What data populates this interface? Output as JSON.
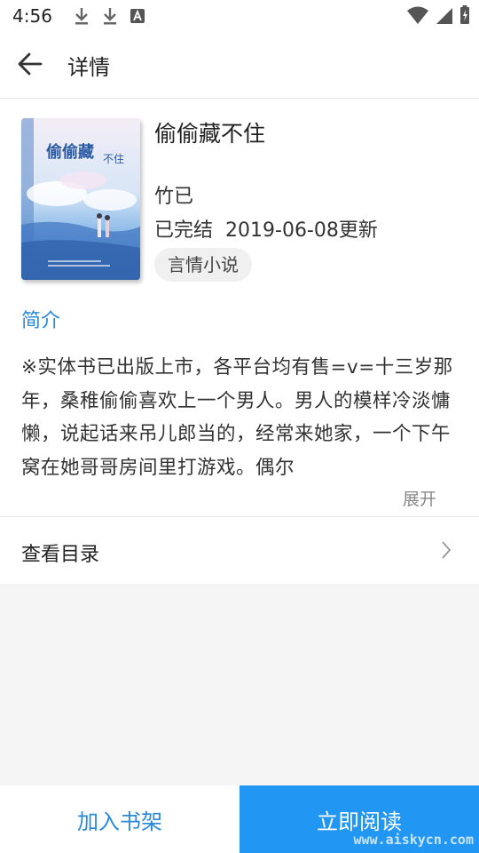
{
  "status_bar": {
    "time": "4:56"
  },
  "app_bar": {
    "title": "详情"
  },
  "book": {
    "title": "偷偷藏不住",
    "author": "竹已",
    "status": "已完结",
    "updated": "2019-06-08更新",
    "genre": "言情小说",
    "cover_title": "偷偷藏不住"
  },
  "intro": {
    "heading": "简介",
    "text": "※实体书已出版上市，各平台均有售=v=十三岁那年，桑稚偷偷喜欢上一个男人。男人的模样冷淡慵懒，说起话来吊儿郎当的，经常来她家，一个下午窝在她哥哥房间里打游戏。偶尔",
    "expand_label": "展开"
  },
  "toc": {
    "label": "查看目录"
  },
  "bottom_bar": {
    "add_to_shelf": "加入书架",
    "read_now": "立即阅读"
  },
  "watermark": "www.aiskycn.com",
  "colors": {
    "accent": "#2196f3",
    "link": "#2a8ad8"
  }
}
